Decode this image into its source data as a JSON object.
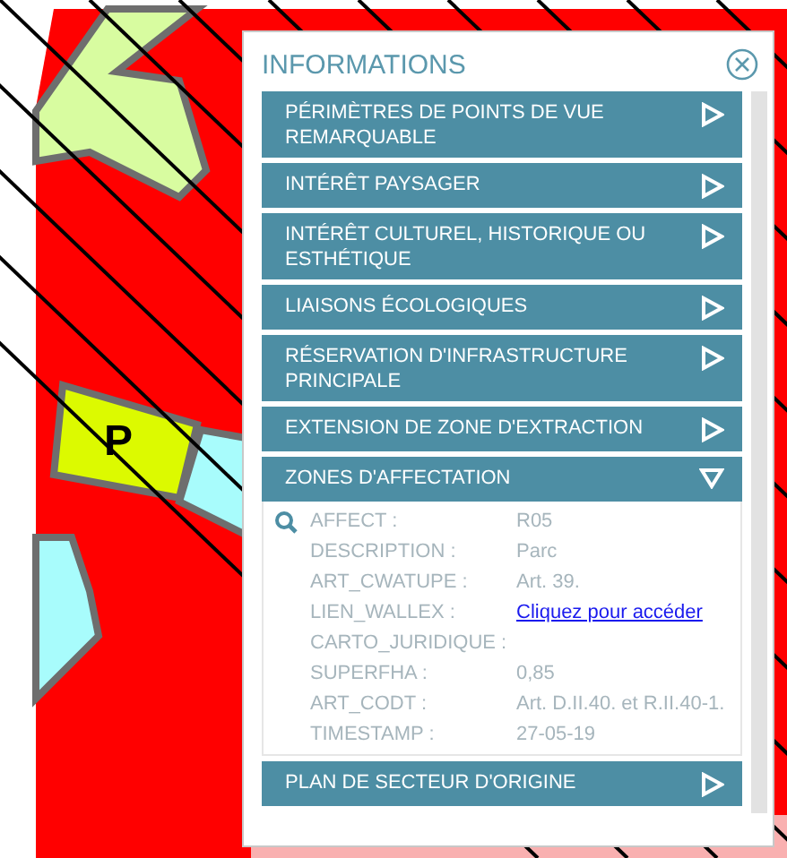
{
  "map": {
    "label": "P"
  },
  "panel": {
    "title": "INFORMATIONS",
    "sections": [
      {
        "title": "PÉRIMÈTRES DE POINTS DE VUE REMARQUABLE",
        "expanded": false
      },
      {
        "title": "INTÉRÊT PAYSAGER",
        "expanded": false
      },
      {
        "title": "INTÉRÊT CULTUREL, HISTORIQUE OU ESTHÉTIQUE",
        "expanded": false
      },
      {
        "title": "LIAISONS ÉCOLOGIQUES",
        "expanded": false
      },
      {
        "title": "RÉSERVATION D'INFRASTRUCTURE PRINCIPALE",
        "expanded": false
      },
      {
        "title": "EXTENSION DE ZONE D'EXTRACTION",
        "expanded": false
      },
      {
        "title": "ZONES D'AFFECTATION",
        "expanded": true,
        "attributes": [
          {
            "label": "AFFECT :",
            "value": "R05",
            "kind": "text"
          },
          {
            "label": "DESCRIPTION :",
            "value": "Parc",
            "kind": "text"
          },
          {
            "label": "ART_CWATUPE :",
            "value": "Art. 39.",
            "kind": "text"
          },
          {
            "label": "LIEN_WALLEX :",
            "value": "Cliquez pour accéder",
            "kind": "link"
          },
          {
            "label": "CARTO_JURIDIQUE :",
            "kind": "text"
          },
          {
            "label": "SUPERFHA :",
            "value": "0,85",
            "kind": "text"
          },
          {
            "label": "ART_CODT :",
            "value": "Art. D.II.40. et R.II.40-1.",
            "kind": "text"
          },
          {
            "label": "TIMESTAMP :",
            "value": "27-05-19",
            "kind": "text"
          }
        ]
      },
      {
        "title": "PLAN DE SECTEUR D'ORIGINE",
        "expanded": false
      }
    ]
  }
}
